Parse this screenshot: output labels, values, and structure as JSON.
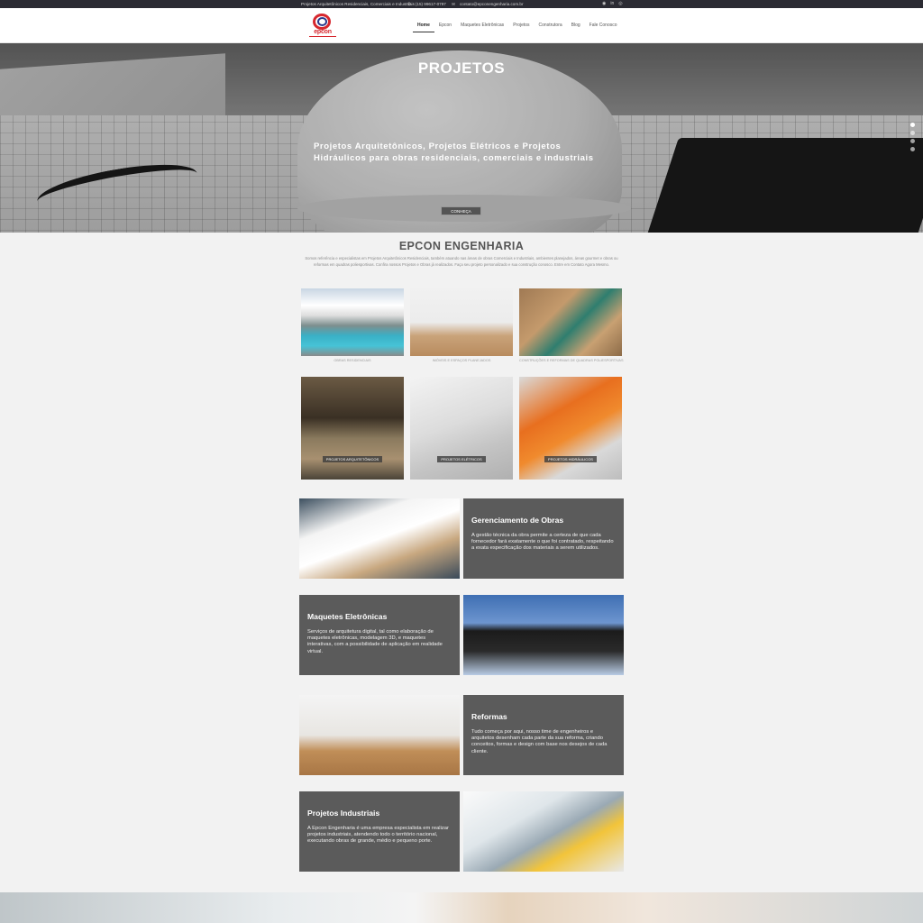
{
  "topbar": {
    "tagline": "Projetos Arquitetônicos Residenciais, Comerciais e Industriais",
    "phone": "(15) 99617-0797",
    "email": "contato@epconengenharia.com.br"
  },
  "header": {
    "logo_text": "epcon",
    "nav": [
      "Home",
      "Epcon",
      "Maquetes Eletrônicas",
      "Projetos",
      "Construtora",
      "Blog",
      "Fale Conosco"
    ]
  },
  "hero": {
    "title": "PROJETOS",
    "subtitle_line1": "Projetos Arquitetônicos, Projetos Elétricos e Projetos",
    "subtitle_line2": "Hidráulicos para obras residenciais, comerciais e industriais",
    "button_label": "CONHEÇA"
  },
  "intro": {
    "title": "EPCON ENGENHARIA",
    "description": "Somos referência e especialistas em Projetos Arquitetônicos Residenciais, também atuando nas áreas de obras Comerciais e Industriais, ambientes planejados, áreas gourmet e obras ou reformas em quadras poliesportivas. Confira nossos Projetos e Obras já realizados. Faça seu projeto personalizado e sua construção conosco. Entre em Contato Agora Mesmo."
  },
  "tiles_row1": [
    {
      "caption": "OBRAS RESIDENCIAIS"
    },
    {
      "caption": "IMÓVEIS E ESPAÇOS PLANEJADOS"
    },
    {
      "caption": "CONSTRUÇÕES E REFORMAS DE QUADRAS POLIESPORTIVAS"
    }
  ],
  "tiles_row2": [
    {
      "tag": "PROJETOS ARQUITETÔNICOS"
    },
    {
      "tag": "PROJETOS ELÉTRICOS"
    },
    {
      "tag": "PROJETOS HIDRÁULICOS"
    }
  ],
  "features": [
    {
      "title": "Gerenciamento de Obras",
      "text": "A gestão técnica da obra permite a certeza de que cada fornecedor fará exatamente o que foi contratado, respeitando a exata especificação dos materiais a serem utilizados."
    },
    {
      "title": "Maquetes Eletrônicas",
      "text": "Serviços de arquitetura digital, tal como elaboração de maquetes eletrônicas, modelagem 3D, e maquetes interativas, com a possibilidade de aplicação em realidade virtual."
    },
    {
      "title": "Reformas",
      "text": "Tudo começa por aqui, nosso time de engenheiros e arquitetos desenham cada parte da sua reforma, criando conceitos, formas e design com base nos desejos de cada cliente."
    },
    {
      "title": "Projetos Industriais",
      "text": "A Epcon Engenharia é uma empresa especialista em realizar projetos industriais, atendendo todo o território nacional, executando obras de grande, médio e pequeno porte."
    }
  ],
  "colors": {
    "topbar": "#2b2b33",
    "feature_box": "#5b5b5b",
    "brand_red": "#d6272e",
    "brand_blue": "#2b3a8c"
  }
}
